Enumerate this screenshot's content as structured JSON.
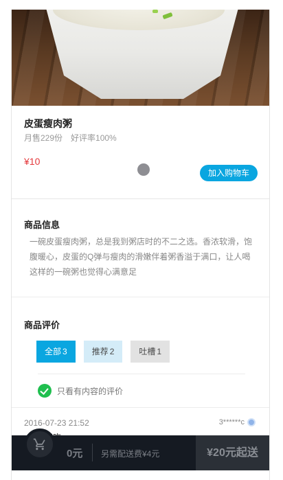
{
  "product": {
    "name": "皮蛋瘦肉粥",
    "monthly_sales": "月售229份",
    "rating": "好评率100%",
    "price": "¥10",
    "add_cart_label": "加入购物车"
  },
  "info_section": {
    "title": "商品信息",
    "description": "一碗皮蛋瘦肉粥，总是我到粥店时的不二之选。香浓软滑，饱腹暖心，皮蛋的Q弹与瘦肉的滑嫩伴着粥香溢于满口，让人喝这样的一碗粥也觉得心满意足"
  },
  "review_section": {
    "title": "商品评价",
    "tabs": [
      {
        "label": "全部",
        "count": "3"
      },
      {
        "label": "推荐",
        "count": "2"
      },
      {
        "label": "吐槽",
        "count": "1"
      }
    ],
    "only_content_label": "只看有内容的评价",
    "reviews": [
      {
        "date": "2016-07-23 21:52",
        "user": "3******c",
        "text": "很好吃"
      }
    ]
  },
  "cart_bar": {
    "total": "0元",
    "delivery_fee": "另需配送费¥4元",
    "min_order": "¥20元起送"
  },
  "colors": {
    "accent": "#0aa6e0",
    "price": "#e4393c",
    "bar_bg": "#151a22",
    "check": "#1fbf4f"
  }
}
